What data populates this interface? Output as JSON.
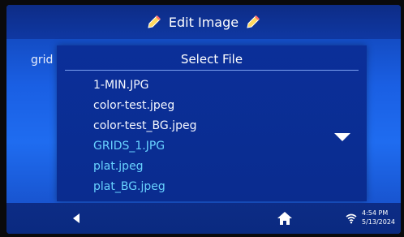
{
  "header": {
    "title": "Edit Image",
    "left_icon": "pencil-icon",
    "right_icon": "pencil-icon"
  },
  "background": {
    "label": "grid"
  },
  "dialog": {
    "title": "Select File",
    "files": [
      {
        "name": "1-MIN.JPG",
        "color": "white"
      },
      {
        "name": "color-test.jpeg",
        "color": "white"
      },
      {
        "name": "color-test_BG.jpeg",
        "color": "white"
      },
      {
        "name": "GRIDS_1.JPG",
        "color": "blue"
      },
      {
        "name": "plat.jpeg",
        "color": "blue"
      },
      {
        "name": "plat_BG.jpeg",
        "color": "blue"
      }
    ],
    "scroll_icon": "triangle-down-icon"
  },
  "footer": {
    "back_icon": "triangle-left-icon",
    "home_icon": "home-icon",
    "wifi_icon": "wifi-icon",
    "time": "4:54 PM",
    "date": "5/13/2024"
  },
  "colors": {
    "accent": "#1f6cf0",
    "list_white": "#f4f7ff",
    "list_blue": "#68d2ff"
  }
}
